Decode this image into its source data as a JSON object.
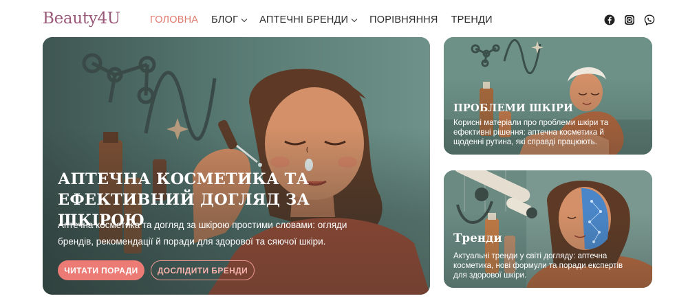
{
  "logo": "Beauty4U",
  "nav": {
    "items": [
      {
        "label": "ГОЛОВНА",
        "active": true,
        "dropdown": false
      },
      {
        "label": "БЛОГ",
        "active": false,
        "dropdown": true
      },
      {
        "label": "АПТЕЧНІ БРЕНДИ",
        "active": false,
        "dropdown": true
      },
      {
        "label": "ПОРІВНЯННЯ",
        "active": false,
        "dropdown": false
      },
      {
        "label": "ТРЕНДИ",
        "active": false,
        "dropdown": false
      }
    ]
  },
  "socials": [
    "facebook-icon",
    "instagram-icon",
    "viber-icon"
  ],
  "hero": {
    "title": "Аптечна косметика та ефективний догляд за шкірою",
    "text": "Аптечна косметика та догляд за шкірою простими словами: огляди брендів, рекомендації й поради для здорової та сяючої шкіри.",
    "primary_button": "ЧИТАТИ ПОРАДИ",
    "secondary_button": "ДОСЛІДИТИ БРЕНДИ"
  },
  "cards": [
    {
      "title": "Проблеми шкіри",
      "text": "Корисні матеріали про проблеми шкіри та ефективні рішення: аптечна косметика й щоденні рутина, які справді працюють."
    },
    {
      "title": "Тренди",
      "text": "Актуальні тренди у світі догляду: аптечна косметика, нові формули та поради експертів для здорової шкіри."
    }
  ],
  "colors": {
    "brand": "#9a5878",
    "accent": "#ec7b75",
    "nav_active": "#e07a6e",
    "hero_bg": "#4f6b66",
    "card_bg": "#6d9187"
  }
}
